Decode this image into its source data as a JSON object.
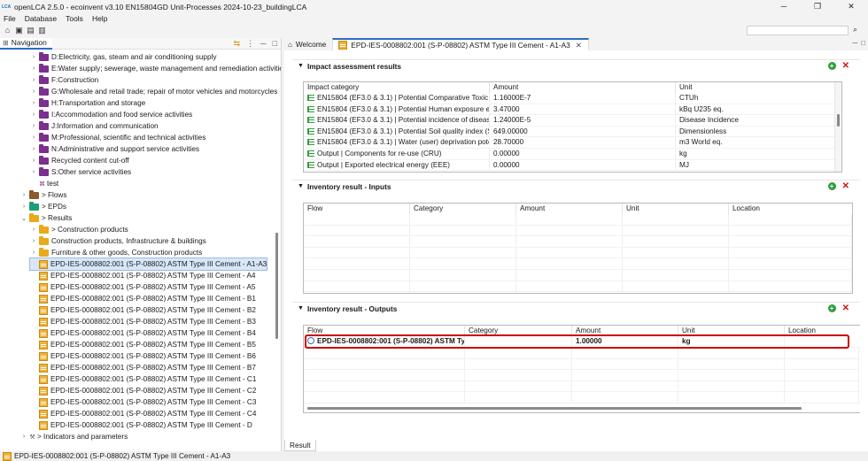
{
  "window": {
    "title": "openLCA 2.5.0 - ecoinvent v3.10 EN15804GD Unit-Processes 2024-10-23_buildingLCA",
    "logo_text": "LCA",
    "minimize": "─",
    "maximize": "❐",
    "close": "✕"
  },
  "menu": [
    "File",
    "Database",
    "Tools",
    "Help"
  ],
  "nav": {
    "tab_label": "Navigation",
    "items": [
      {
        "label": "D:Electricity, gas, steam and air conditioning supply",
        "indent": 3,
        "icon": "purple",
        "twisty": ">"
      },
      {
        "label": "E:Water supply; sewerage, waste management and remediation activities",
        "indent": 3,
        "icon": "purple",
        "twisty": ">"
      },
      {
        "label": "F:Construction",
        "indent": 3,
        "icon": "purple",
        "twisty": ">"
      },
      {
        "label": "G:Wholesale and retail trade; repair of motor vehicles and motorcycles",
        "indent": 3,
        "icon": "purple",
        "twisty": ">"
      },
      {
        "label": "H:Transportation and storage",
        "indent": 3,
        "icon": "purple",
        "twisty": ">"
      },
      {
        "label": "I:Accommodation and food service activities",
        "indent": 3,
        "icon": "purple",
        "twisty": ">"
      },
      {
        "label": "J:Information and communication",
        "indent": 3,
        "icon": "purple",
        "twisty": ">"
      },
      {
        "label": "M:Professional, scientific and technical activities",
        "indent": 3,
        "icon": "purple",
        "twisty": ">"
      },
      {
        "label": "N:Administrative and support service activities",
        "indent": 3,
        "icon": "purple",
        "twisty": ">"
      },
      {
        "label": "Recycled content cut-off",
        "indent": 3,
        "icon": "purple",
        "twisty": ">"
      },
      {
        "label": "S:Other service activities",
        "indent": 3,
        "icon": "purple",
        "twisty": ">"
      },
      {
        "label": "test",
        "indent": 3,
        "icon": "process",
        "twisty": ""
      },
      {
        "label": "> Flows",
        "indent": 2,
        "icon": "brown",
        "twisty": ">"
      },
      {
        "label": "> EPDs",
        "indent": 2,
        "icon": "teal",
        "twisty": ">"
      },
      {
        "label": "> Results",
        "indent": 2,
        "icon": "yellow",
        "twisty": "v"
      },
      {
        "label": "> Construction products",
        "indent": 3,
        "icon": "yellow",
        "twisty": ">"
      },
      {
        "label": "Construction products, Infrastructure & buildings",
        "indent": 3,
        "icon": "yellow",
        "twisty": ">"
      },
      {
        "label": "Furniture & other goods, Construction products",
        "indent": 3,
        "icon": "yellow",
        "twisty": ">"
      },
      {
        "label": "EPD-IES-0008802:001 (S-P-08802) ASTM Type III Cement - A1-A3",
        "indent": 3,
        "icon": "result",
        "twisty": "",
        "selected": true
      },
      {
        "label": "EPD-IES-0008802:001 (S-P-08802) ASTM Type III Cement - A4",
        "indent": 3,
        "icon": "result",
        "twisty": ""
      },
      {
        "label": "EPD-IES-0008802:001 (S-P-08802) ASTM Type III Cement - A5",
        "indent": 3,
        "icon": "result",
        "twisty": ""
      },
      {
        "label": "EPD-IES-0008802:001 (S-P-08802) ASTM Type III Cement - B1",
        "indent": 3,
        "icon": "result",
        "twisty": ""
      },
      {
        "label": "EPD-IES-0008802:001 (S-P-08802) ASTM Type III Cement - B2",
        "indent": 3,
        "icon": "result",
        "twisty": ""
      },
      {
        "label": "EPD-IES-0008802:001 (S-P-08802) ASTM Type III Cement - B3",
        "indent": 3,
        "icon": "result",
        "twisty": ""
      },
      {
        "label": "EPD-IES-0008802:001 (S-P-08802) ASTM Type III Cement - B4",
        "indent": 3,
        "icon": "result",
        "twisty": ""
      },
      {
        "label": "EPD-IES-0008802:001 (S-P-08802) ASTM Type III Cement - B5",
        "indent": 3,
        "icon": "result",
        "twisty": ""
      },
      {
        "label": "EPD-IES-0008802:001 (S-P-08802) ASTM Type III Cement - B6",
        "indent": 3,
        "icon": "result",
        "twisty": ""
      },
      {
        "label": "EPD-IES-0008802:001 (S-P-08802) ASTM Type III Cement - B7",
        "indent": 3,
        "icon": "result",
        "twisty": ""
      },
      {
        "label": "EPD-IES-0008802:001 (S-P-08802) ASTM Type III Cement - C1",
        "indent": 3,
        "icon": "result",
        "twisty": ""
      },
      {
        "label": "EPD-IES-0008802:001 (S-P-08802) ASTM Type III Cement - C2",
        "indent": 3,
        "icon": "result",
        "twisty": ""
      },
      {
        "label": "EPD-IES-0008802:001 (S-P-08802) ASTM Type III Cement - C3",
        "indent": 3,
        "icon": "result",
        "twisty": ""
      },
      {
        "label": "EPD-IES-0008802:001 (S-P-08802) ASTM Type III Cement - C4",
        "indent": 3,
        "icon": "result",
        "twisty": ""
      },
      {
        "label": "EPD-IES-0008802:001 (S-P-08802) ASTM Type III Cement - D",
        "indent": 3,
        "icon": "result",
        "twisty": ""
      },
      {
        "label": "> Indicators and parameters",
        "indent": 2,
        "icon": "tool",
        "twisty": ">"
      }
    ]
  },
  "editor": {
    "tabs": [
      {
        "label": "Welcome",
        "icon": "home-icon"
      },
      {
        "label": "EPD-IES-0008802:001 (S-P-08802) ASTM Type III Cement - A1-A3",
        "icon": "result-icon",
        "active": true
      }
    ],
    "impact": {
      "title": "Impact assessment results",
      "columns": [
        "Impact category",
        "Amount",
        "Unit"
      ],
      "rows": [
        [
          "EN15804 (EF3.0 & 3.1) | Potential Comparative Toxic Un...",
          "1.16000E-7",
          "CTUh"
        ],
        [
          "EN15804 (EF3.0 & 3.1) | Potential Human exposure effic...",
          "3.47000",
          "kBq U235 eq."
        ],
        [
          "EN15804 (EF3.0 & 3.1) | Potential incidence of disease d...",
          "1.24000E-5",
          "Disease Incidence"
        ],
        [
          "EN15804 (EF3.0 & 3.1) | Potential Soil quality index (SQP)",
          "649.00000",
          "Dimensionless"
        ],
        [
          "EN15804 (EF3.0 & 3.1) | Water (user) deprivation potent...",
          "28.70000",
          "m3 World eq."
        ],
        [
          "Output | Components for re-use (CRU)",
          "0.00000",
          "kg"
        ],
        [
          "Output | Exported electrical energy (EEE)",
          "0.00000",
          "MJ"
        ]
      ]
    },
    "inputs": {
      "title": "Inventory result - Inputs",
      "columns": [
        "Flow",
        "Category",
        "Amount",
        "Unit",
        "Location"
      ]
    },
    "outputs": {
      "title": "Inventory result - Outputs",
      "columns": [
        "Flow",
        "Category",
        "Amount",
        "Unit",
        "Location"
      ],
      "rows": [
        [
          "EPD-IES-0008802:001 (S-P-08802) ASTM Ty...",
          "",
          "1.00000",
          "kg",
          ""
        ]
      ]
    },
    "bottom_tab": "Result"
  },
  "status": {
    "text": "EPD-IES-0008802:001 (S-P-08802) ASTM Type III Cement - A1-A3"
  },
  "colors": {
    "accent": "#2a6dc6",
    "highlight": "#c90000",
    "add": "#2e9e3a",
    "remove": "#dd1111"
  }
}
